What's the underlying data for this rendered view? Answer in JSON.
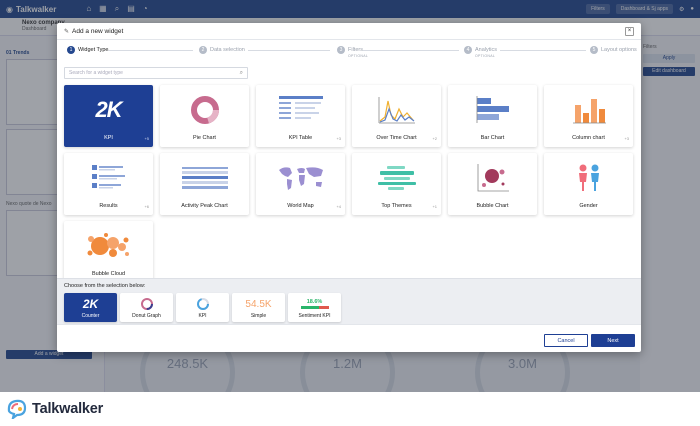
{
  "app": {
    "name": "Talkwalker",
    "top_pill_left": "Filters",
    "top_pill_right": "Dashboard & Sj apps",
    "project_name": "Nexo company",
    "project_sub": "Dashboard",
    "sidebar_section": "01 Trends",
    "sidebar_section_2": "Nexo quote de Nexo",
    "add_widget_label": "Add a widget",
    "right_label": "Filters",
    "right_btn_1": "Apply",
    "right_btn_2": "Edit dashboard",
    "bg_metrics": [
      {
        "value": "248.5K"
      },
      {
        "value": "1.2M"
      },
      {
        "value": "3.0M"
      }
    ]
  },
  "modal": {
    "title": "Add a new widget",
    "close_label": "×",
    "steps": [
      {
        "num": "1",
        "label": "Widget Type",
        "sub": ""
      },
      {
        "num": "2",
        "label": "Data selection",
        "sub": ""
      },
      {
        "num": "3",
        "label": "Filters",
        "sub": "OPTIONAL"
      },
      {
        "num": "4",
        "label": "Analytics",
        "sub": "OPTIONAL"
      },
      {
        "num": "5",
        "label": "Layout options",
        "sub": ""
      }
    ],
    "search_placeholder": "Search for a widget type",
    "widgets": [
      {
        "label": "KPI",
        "count": "+5",
        "selected": true
      },
      {
        "label": "Pie Chart",
        "count": ""
      },
      {
        "label": "KPI Table",
        "count": "+3"
      },
      {
        "label": "Over Time Chart",
        "count": "+2"
      },
      {
        "label": "Bar Chart",
        "count": ""
      },
      {
        "label": "Column chart",
        "count": "+3"
      },
      {
        "label": "Results",
        "count": "+6"
      },
      {
        "label": "Activity Peak Chart",
        "count": ""
      },
      {
        "label": "World Map",
        "count": "+4"
      },
      {
        "label": "Top Themes",
        "count": "+1"
      },
      {
        "label": "Bubble Chart",
        "count": ""
      },
      {
        "label": "Gender",
        "count": ""
      },
      {
        "label": "Bubble Cloud",
        "count": ""
      }
    ],
    "chooser_title": "Choose from the selection below:",
    "options": [
      {
        "label": "Counter",
        "art_text": "2K",
        "selected": true
      },
      {
        "label": "Donut Graph",
        "art_text": ""
      },
      {
        "label": "KPI",
        "art_text": ""
      },
      {
        "label": "Simple",
        "art_text": "54.5K"
      },
      {
        "label": "Sentiment KPI",
        "art_text": "18.6%"
      }
    ],
    "kpi_art_text": "2K",
    "cancel_label": "Cancel",
    "next_label": "Next"
  },
  "brand": {
    "wordmark": "Talkwalker"
  },
  "colors": {
    "primary": "#1e3f94",
    "nav": "#24488f",
    "pie": "#c76b8e",
    "orange": "#f08a3c",
    "bar_blue": "#5b7fc7",
    "teal": "#3fbfa6"
  }
}
